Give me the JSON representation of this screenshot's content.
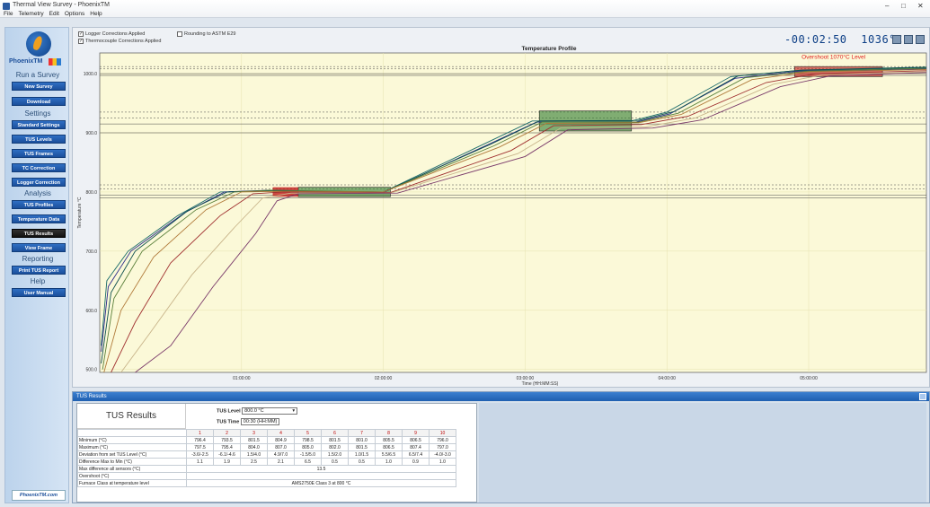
{
  "window": {
    "title": "Thermal View Survey - PhoenixTM",
    "menu": [
      "File",
      "Telemetry",
      "Edit",
      "Options",
      "Help"
    ],
    "controls": [
      "–",
      "□",
      "✕"
    ]
  },
  "sidebar": {
    "brand": "PhoenixTM",
    "sections": [
      {
        "title": "Run a Survey",
        "items": [
          {
            "label": "New Survey",
            "active": false
          },
          {
            "label": "Download",
            "active": false
          }
        ]
      },
      {
        "title": "Settings",
        "items": [
          {
            "label": "Standard Settings",
            "active": false
          },
          {
            "label": "TUS Levels",
            "active": false
          },
          {
            "label": "TUS Frames",
            "active": false
          },
          {
            "label": "TC Correction",
            "active": false
          },
          {
            "label": "Logger Correction",
            "active": false
          }
        ]
      },
      {
        "title": "Analysis",
        "items": [
          {
            "label": "TUS Profiles",
            "active": false
          },
          {
            "label": "Temperature Data",
            "active": false
          },
          {
            "label": "TUS Results",
            "active": true
          },
          {
            "label": "View Frame",
            "active": false
          }
        ]
      },
      {
        "title": "Reporting",
        "items": [
          {
            "label": "Print TUS Report",
            "active": false
          }
        ]
      },
      {
        "title": "Help",
        "items": [
          {
            "label": "User Manual",
            "active": false
          }
        ]
      }
    ],
    "site_link": "PhoenixTM.com"
  },
  "options": {
    "logger_corr": {
      "label": "Logger Corrections Applied",
      "checked": true
    },
    "tc_corr": {
      "label": "Thermocouple Corrections Applied",
      "checked": true
    },
    "rounding": {
      "label": "Rounding to ASTM E29",
      "checked": false
    }
  },
  "readout": {
    "elapsed": "-00:02:50",
    "temperature": "1036°C"
  },
  "chart_data": {
    "type": "line",
    "title": "Temperature Profile",
    "xlabel": "Time (HH:MM:SS)",
    "ylabel": "Temperature °C",
    "x_ticks": [
      "01:00:00",
      "02:00:00",
      "03:00:00",
      "04:00:00",
      "05:00:00"
    ],
    "y_ticks": [
      1000.0,
      900.0,
      800.0,
      700.0,
      600.0,
      500.0
    ],
    "xlim": [
      0.0,
      5.83
    ],
    "ylim": [
      495,
      1035
    ],
    "annotation": "Overshoot 1070°C Level",
    "tus_frames": [
      {
        "x0": 1.4,
        "x1": 2.05,
        "y0": 792,
        "y1": 808,
        "color": "#2f7a2f"
      },
      {
        "x0": 3.1,
        "x1": 3.75,
        "y0": 903,
        "y1": 937,
        "color": "#2f7a2f"
      },
      {
        "x0": 4.9,
        "x1": 5.52,
        "y0": 995,
        "y1": 1012,
        "color": "#c21b1b"
      }
    ],
    "red_marks": [
      {
        "x0": 1.22,
        "x1": 1.4,
        "y0": 792,
        "y1": 808
      }
    ],
    "tolerance_lines": [
      805,
      795,
      812,
      790,
      925,
      915,
      935,
      900,
      1008,
      997,
      1012,
      1000
    ],
    "series": [
      {
        "color": "#1b6b6b",
        "values": [
          [
            0.01,
            540
          ],
          [
            0.05,
            650
          ],
          [
            0.2,
            700
          ],
          [
            0.55,
            760
          ],
          [
            0.85,
            800
          ],
          [
            1.2,
            802
          ],
          [
            2.0,
            800
          ],
          [
            2.7,
            880
          ],
          [
            3.05,
            920
          ],
          [
            3.75,
            920
          ],
          [
            4.0,
            935
          ],
          [
            4.45,
            995
          ],
          [
            4.9,
            1005
          ],
          [
            5.83,
            1010
          ]
        ]
      },
      {
        "color": "#2a2a8a",
        "values": [
          [
            0.01,
            530
          ],
          [
            0.06,
            640
          ],
          [
            0.22,
            700
          ],
          [
            0.6,
            765
          ],
          [
            0.88,
            800
          ],
          [
            1.2,
            803
          ],
          [
            2.0,
            799
          ],
          [
            2.72,
            878
          ],
          [
            3.08,
            918
          ],
          [
            3.78,
            918
          ],
          [
            4.02,
            932
          ],
          [
            4.48,
            992
          ],
          [
            4.92,
            1004
          ],
          [
            5.83,
            1008
          ]
        ]
      },
      {
        "color": "#0d4f4f",
        "values": [
          [
            0.01,
            510
          ],
          [
            0.08,
            630
          ],
          [
            0.25,
            700
          ],
          [
            0.62,
            768
          ],
          [
            0.9,
            800
          ],
          [
            1.2,
            802
          ],
          [
            2.0,
            800
          ],
          [
            2.75,
            880
          ],
          [
            3.1,
            920
          ],
          [
            3.8,
            921
          ],
          [
            4.05,
            936
          ],
          [
            4.5,
            996
          ],
          [
            4.95,
            1006
          ],
          [
            5.83,
            1011
          ]
        ]
      },
      {
        "color": "#5a7f3a",
        "values": [
          [
            0.02,
            500
          ],
          [
            0.1,
            620
          ],
          [
            0.3,
            700
          ],
          [
            0.68,
            770
          ],
          [
            0.95,
            800
          ],
          [
            1.2,
            803
          ],
          [
            2.0,
            800
          ],
          [
            2.78,
            878
          ],
          [
            3.12,
            918
          ],
          [
            3.8,
            918
          ],
          [
            4.08,
            933
          ],
          [
            4.55,
            993
          ],
          [
            4.98,
            1004
          ],
          [
            5.83,
            1009
          ]
        ]
      },
      {
        "color": "#b07a3a",
        "values": [
          [
            0.03,
            495
          ],
          [
            0.15,
            600
          ],
          [
            0.38,
            690
          ],
          [
            0.75,
            770
          ],
          [
            1.0,
            800
          ],
          [
            1.25,
            801
          ],
          [
            2.0,
            800
          ],
          [
            2.82,
            876
          ],
          [
            3.15,
            916
          ],
          [
            3.8,
            917
          ],
          [
            4.1,
            931
          ],
          [
            4.6,
            990
          ],
          [
            5.0,
            1003
          ],
          [
            5.83,
            1007
          ]
        ]
      },
      {
        "color": "#a03030",
        "values": [
          [
            0.08,
            495
          ],
          [
            0.25,
            580
          ],
          [
            0.5,
            680
          ],
          [
            0.85,
            760
          ],
          [
            1.08,
            797
          ],
          [
            1.3,
            800
          ],
          [
            2.05,
            799
          ],
          [
            2.9,
            870
          ],
          [
            3.2,
            912
          ],
          [
            3.82,
            914
          ],
          [
            4.15,
            928
          ],
          [
            4.7,
            985
          ],
          [
            5.05,
            1000
          ],
          [
            5.83,
            1005
          ]
        ]
      },
      {
        "color": "#c8b48a",
        "values": [
          [
            0.15,
            495
          ],
          [
            0.35,
            560
          ],
          [
            0.65,
            660
          ],
          [
            0.95,
            740
          ],
          [
            1.15,
            790
          ],
          [
            1.35,
            798
          ],
          [
            2.05,
            798
          ],
          [
            2.95,
            865
          ],
          [
            3.25,
            908
          ],
          [
            3.85,
            910
          ],
          [
            4.2,
            925
          ],
          [
            4.75,
            982
          ],
          [
            5.1,
            998
          ],
          [
            5.83,
            1003
          ]
        ]
      },
      {
        "color": "#7a3a6a",
        "values": [
          [
            0.25,
            495
          ],
          [
            0.5,
            540
          ],
          [
            0.8,
            640
          ],
          [
            1.1,
            730
          ],
          [
            1.25,
            785
          ],
          [
            1.4,
            797
          ],
          [
            2.1,
            798
          ],
          [
            3.0,
            860
          ],
          [
            3.3,
            905
          ],
          [
            3.9,
            908
          ],
          [
            4.25,
            922
          ],
          [
            4.8,
            978
          ],
          [
            5.15,
            996
          ],
          [
            5.83,
            1002
          ]
        ]
      }
    ]
  },
  "results": {
    "header": "TUS Results",
    "title": "TUS Results",
    "tus_level_label": "TUS Level",
    "tus_level_value": "800.0 °C",
    "tus_time_label": "TUS Time",
    "tus_time_value": "00:30 (HH:MM)",
    "columns": [
      "1",
      "2",
      "3",
      "4",
      "5",
      "6",
      "7",
      "8",
      "9",
      "10"
    ],
    "rows": [
      {
        "label": "Minimum (°C)",
        "values": [
          "796.4",
          "793.5",
          "801.5",
          "804.9",
          "798.5",
          "801.5",
          "801.0",
          "805.5",
          "806.5",
          "796.0"
        ]
      },
      {
        "label": "Maximum (°C)",
        "values": [
          "797.5",
          "795.4",
          "804.0",
          "807.0",
          "805.0",
          "802.0",
          "801.5",
          "806.5",
          "807.4",
          "797.0"
        ]
      },
      {
        "label": "Deviation from set TUS Level (°C)",
        "values": [
          "-3.6/-2.5",
          "-6.1/-4.6",
          "1.5/4.0",
          "4.9/7.0",
          "-1.5/5.0",
          "1.5/2.0",
          "1.0/1.5",
          "5.5/6.5",
          "6.5/7.4",
          "-4.0/-3.0"
        ]
      },
      {
        "label": "Difference Max to Min (°C)",
        "values": [
          "1.1",
          "1.9",
          "2.5",
          "2.1",
          "6.5",
          "0.5",
          "0.5",
          "1.0",
          "0.9",
          "1.0"
        ]
      }
    ],
    "max_diff_label": "Max difference all sensors (°C)",
    "max_diff_value": "13.5",
    "overshoot_label": "Overshoot (°C)",
    "overshoot_value": "",
    "furnace_class_label": "Furnace Class at temperature level",
    "furnace_class_value": "AMS2750E Class 3 at 800 °C"
  }
}
